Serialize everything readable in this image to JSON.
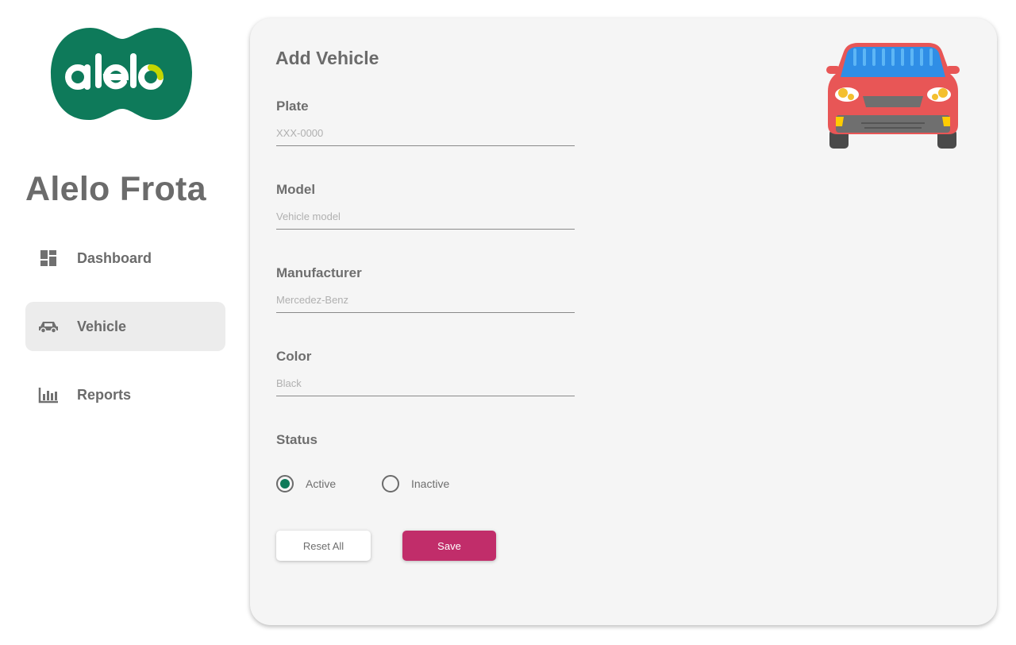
{
  "sidebar": {
    "logo_text": "alelo",
    "app_title": "Alelo Frota",
    "items": [
      {
        "label": "Dashboard",
        "icon": "dashboard-icon",
        "active": false
      },
      {
        "label": "Vehicle",
        "icon": "car-icon",
        "active": true
      },
      {
        "label": "Reports",
        "icon": "bar-chart-icon",
        "active": false
      }
    ]
  },
  "form": {
    "title": "Add Vehicle",
    "illustration": "car-front-illustration",
    "fields": [
      {
        "label": "Plate",
        "placeholder": "XXX-0000",
        "value": ""
      },
      {
        "label": "Model",
        "placeholder": "Vehicle model",
        "value": ""
      },
      {
        "label": "Manufacturer",
        "placeholder": "Mercedez-Benz",
        "value": ""
      },
      {
        "label": "Color",
        "placeholder": "Black",
        "value": ""
      }
    ],
    "status": {
      "label": "Status",
      "options": [
        "Active",
        "Inactive"
      ],
      "selected": "Active"
    },
    "buttons": {
      "reset": "Reset All",
      "save": "Save"
    }
  },
  "colors": {
    "brand_green": "#0e7a5a",
    "accent_lime": "#c4d600",
    "save_button": "#c12d6a",
    "active_nav_bg": "#ececec",
    "card_bg": "#f5f5f5"
  }
}
